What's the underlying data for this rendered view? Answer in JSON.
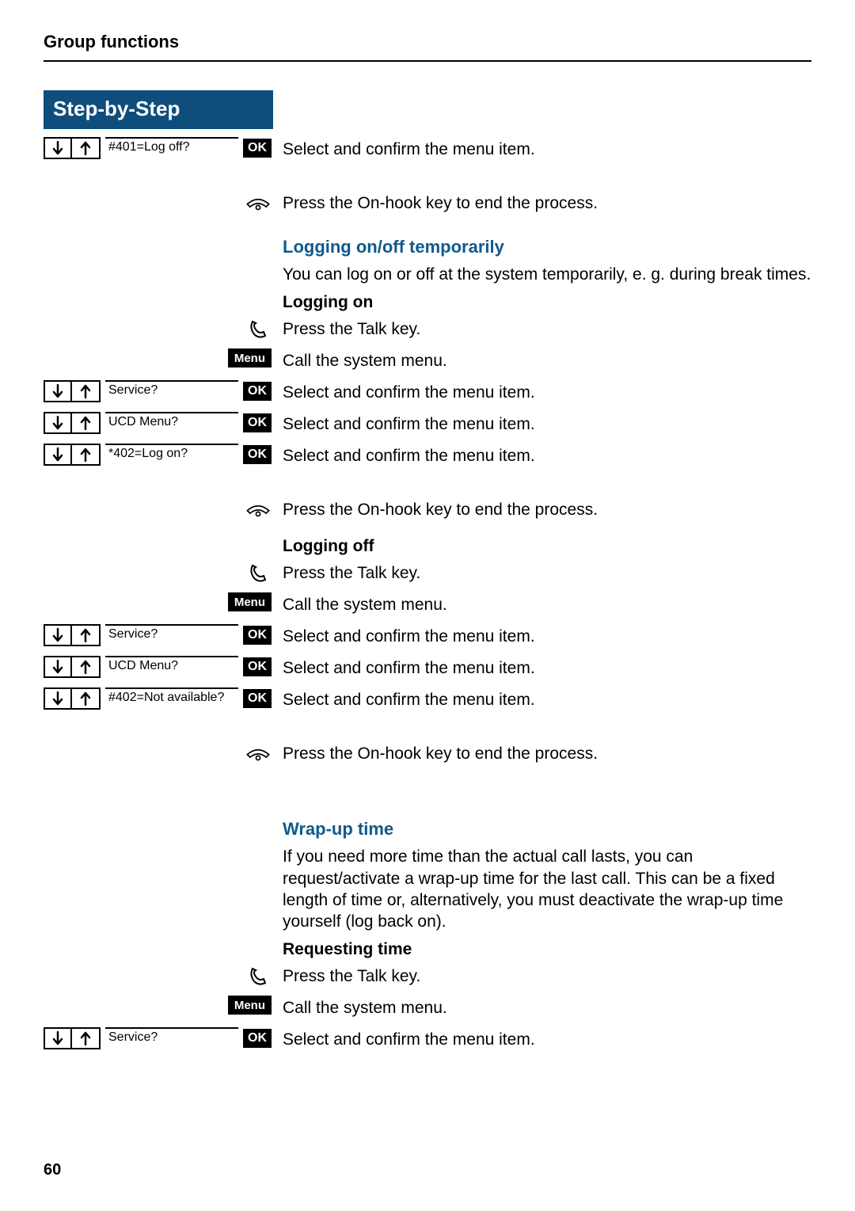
{
  "header": "Group functions",
  "step_header": "Step-by-Step",
  "ok": "OK",
  "menu": "Menu",
  "rows": {
    "r1_label": "#401=Log off?",
    "r1_text": "Select and confirm the menu item.",
    "r2_text": "Press the On-hook key to end the process.",
    "sec1_title": "Logging on/off temporarily",
    "sec1_para": "You can log on or off at the system temporarily, e. g. during break times.",
    "sub1": "Logging on",
    "r3_text": "Press the Talk key.",
    "r4_text": "Call the system menu.",
    "r5_label": "Service?",
    "r5_text": "Select and confirm the menu item.",
    "r6_label": "UCD Menu?",
    "r6_text": "Select and confirm the menu item.",
    "r7_label": "*402=Log on?",
    "r7_text": "Select and confirm the menu item.",
    "r8_text": "Press the On-hook key to end the process.",
    "sub2": "Logging off",
    "r9_text": "Press the Talk key.",
    "r10_text": "Call the system menu.",
    "r11_label": "Service?",
    "r11_text": "Select and confirm the menu item.",
    "r12_label": "UCD Menu?",
    "r12_text": "Select and confirm the menu item.",
    "r13_label": "#402=Not available?",
    "r13_text": "Select and confirm the menu item.",
    "r14_text": "Press the On-hook key to end the process.",
    "sec2_title": "Wrap-up time",
    "sec2_para": "If you need more time than the actual call lasts, you can request/activate a wrap-up time for the last call. This can be a fixed length of time or, alternatively, you must deactivate the wrap-up time yourself (log back on).",
    "sub3": "Requesting time",
    "r15_text": "Press the Talk key.",
    "r16_text": "Call the system menu.",
    "r17_label": "Service?",
    "r17_text": "Select and confirm the menu item."
  },
  "page_number": "60"
}
